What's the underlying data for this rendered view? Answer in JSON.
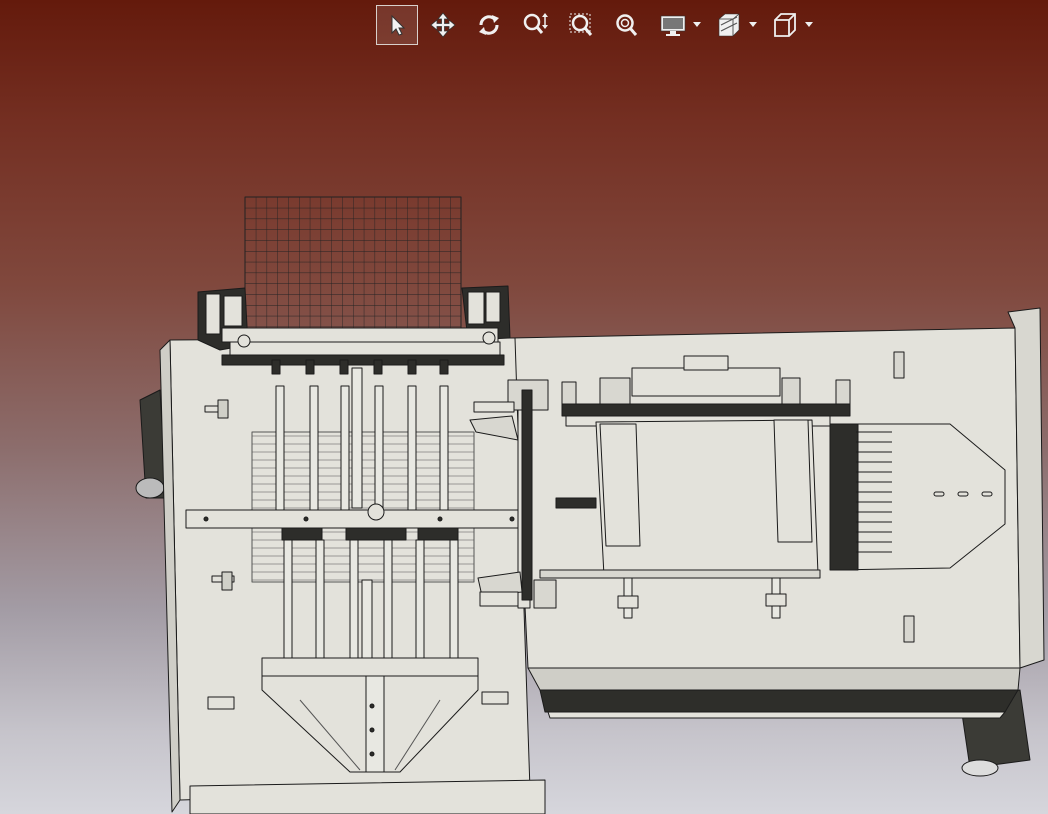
{
  "viewer": {
    "background_top": "#641a0c",
    "background_bottom": "#d6d6dc"
  },
  "toolbar": {
    "tools": [
      {
        "name": "select",
        "icon": "pointer-arrow-icon",
        "active": true
      },
      {
        "name": "pan",
        "icon": "move-arrows-icon",
        "active": false
      },
      {
        "name": "rotate",
        "icon": "rotate-icon",
        "active": false
      },
      {
        "name": "zoom",
        "icon": "zoom-updown-icon",
        "active": false
      },
      {
        "name": "zoom-window",
        "icon": "zoom-window-icon",
        "active": false
      },
      {
        "name": "zoom-fit",
        "icon": "zoom-fit-icon",
        "active": false
      },
      {
        "name": "display",
        "icon": "monitor-icon",
        "active": false,
        "dropdown": true
      },
      {
        "name": "section",
        "icon": "section-view-icon",
        "active": false,
        "dropdown": true
      },
      {
        "name": "view-orientation",
        "icon": "cube-icon",
        "active": false,
        "dropdown": true
      }
    ]
  },
  "model": {
    "type": "3D CAD assembly",
    "colors": {
      "face": "#e3e2db",
      "edge": "#1b1b1b",
      "shade": "#3b3b36"
    }
  }
}
